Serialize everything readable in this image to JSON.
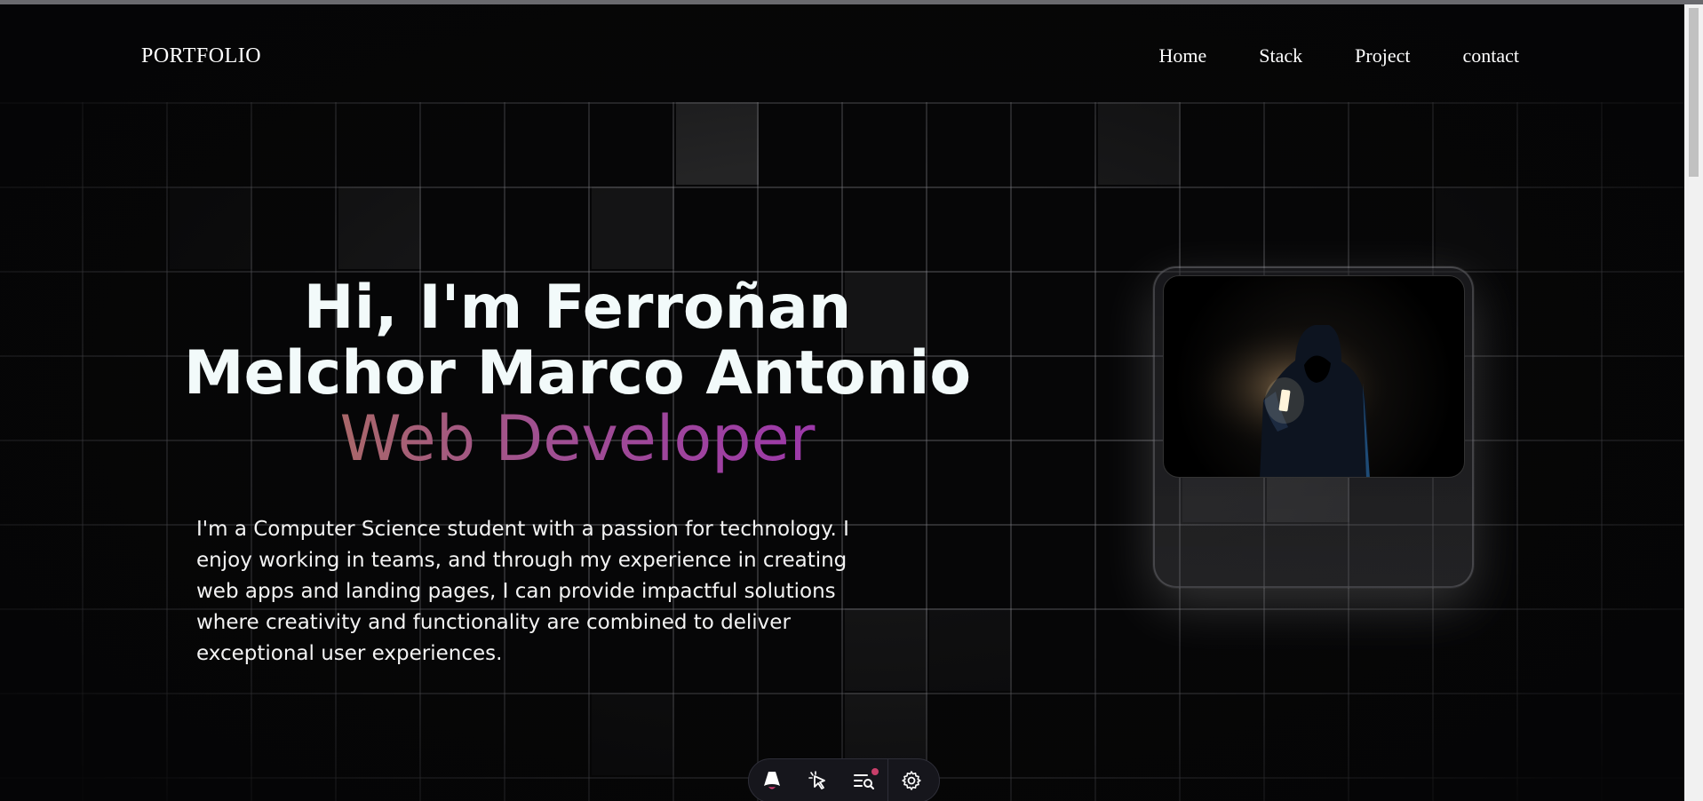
{
  "nav": {
    "brand": "PORTFOLIO",
    "links": [
      "Home",
      "Stack",
      "Project",
      "contact"
    ]
  },
  "hero": {
    "title_line1": "Hi, I'm Ferroñan",
    "title_line2": "Melchor Marco Antonio",
    "role": "Web Developer",
    "bio": "I'm a Computer Science student with a passion for technology. I enjoy working in teams, and through my experience in creating web apps and landing pages, I can provide impactful solutions where creativity and functionality are combined to deliver exceptional user experiences."
  },
  "devtoolbar": {
    "icons": [
      "astro-logo-icon",
      "cursor-select-icon",
      "audit-list-icon",
      "settings-gear-icon"
    ]
  },
  "colors": {
    "background": "#060607",
    "accent_gradient_start": "#b07a48",
    "accent_gradient_end": "#9a2ab8",
    "progress": "#a42ad0"
  }
}
